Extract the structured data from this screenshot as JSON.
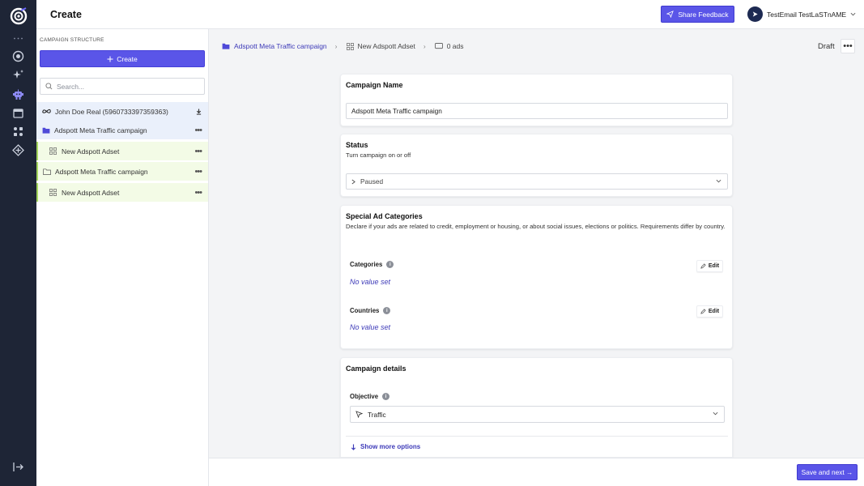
{
  "header": {
    "title": "Create",
    "share_feedback": "Share Feedback",
    "user_name": "TestEmail TestLaSTnAME"
  },
  "rail": {
    "icons": [
      "logo-icon",
      "more-dots-icon",
      "dashboard-icon",
      "sparkles-icon",
      "robot-icon",
      "calendar-icon",
      "apps-icon",
      "integrations-icon",
      "logout-icon"
    ]
  },
  "structure": {
    "heading": "CAMPAIGN STRUCTURE",
    "create_label": "Create",
    "search_placeholder": "Search...",
    "account": "John Doe Real (5960733397359363)",
    "items": [
      {
        "label": "Adspott Meta Traffic campaign",
        "type": "campaign",
        "selected": true
      },
      {
        "label": "New Adspott Adset",
        "type": "adset"
      },
      {
        "label": "Adspott Meta Traffic campaign",
        "type": "campaign"
      },
      {
        "label": "New Adspott Adset",
        "type": "adset"
      }
    ]
  },
  "breadcrumb": {
    "campaign": "Adspott Meta Traffic campaign",
    "adset": "New Adspott Adset",
    "ads": "0 ads"
  },
  "status_label": "Draft",
  "campaign_name": {
    "title": "Campaign Name",
    "value": "Adspott Meta Traffic campaign"
  },
  "status": {
    "title": "Status",
    "subtitle": "Turn campaign on or off",
    "value": "Paused"
  },
  "special": {
    "title": "Special Ad Categories",
    "description": "Declare if your ads are related to credit, employment or housing, or about social issues, elections or politics. Requirements differ by country.",
    "categories_label": "Categories",
    "categories_value": "No value set",
    "countries_label": "Countries",
    "countries_value": "No value set",
    "edit_label": "Edit"
  },
  "details": {
    "title": "Campaign details",
    "objective_label": "Objective",
    "objective_value": "Traffic",
    "show_more": "Show more options"
  },
  "footer": {
    "save_next": "Save and next →"
  },
  "colors": {
    "accent": "#5a55e8",
    "rail": "#1e2536",
    "link": "#3d3ab8",
    "selected_row": "#eaf0fb",
    "adset_row": "#f3fbe6"
  }
}
